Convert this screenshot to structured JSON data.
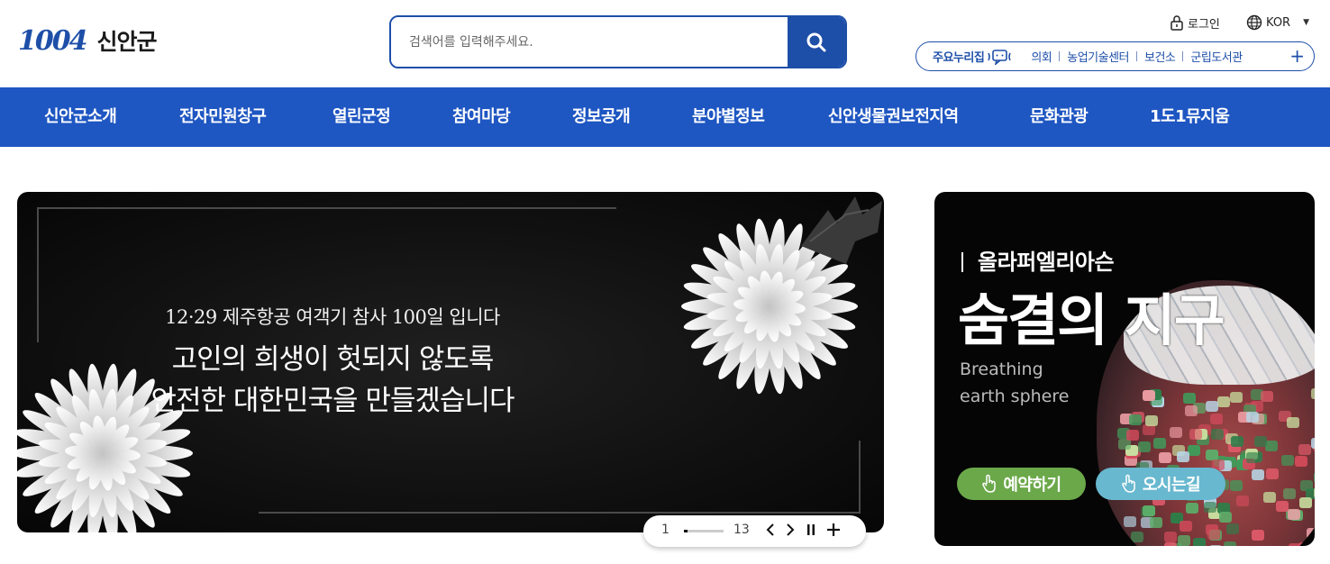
{
  "header": {
    "logo_mark": "1004",
    "logo_text": "신안군",
    "search": {
      "placeholder": "검색어를 입력해주세요."
    },
    "util": {
      "login": "로그인",
      "language": "KOR"
    },
    "quick_links": {
      "title": "주요누리집",
      "items": [
        "의회",
        "농업기술센터",
        "보건소",
        "군립도서관"
      ],
      "more": "+"
    }
  },
  "gnb": {
    "items": [
      "신안군소개",
      "전자민원창구",
      "열린군정",
      "참여마당",
      "정보공개",
      "분야별정보",
      "신안생물권보전지역",
      "문화관광",
      "1도1뮤지움"
    ]
  },
  "main_banner": {
    "subtitle": "12·29 제주항공 여객기 참사 100일 입니다",
    "line1": "고인의 희생이 헛되지 않도록",
    "line2": "안전한 대한민국을 만들겠습니다",
    "pager": {
      "current": "1",
      "total": "13",
      "progress": 0.08
    }
  },
  "side_banner": {
    "subtitle": "올라퍼엘리아슨",
    "title": "숨결의 지구",
    "english_line1": "Breathing",
    "english_line2": "earth sphere",
    "buttons": {
      "book": "예약하기",
      "directions": "오시는길"
    }
  },
  "colors": {
    "primary": "#1e56c2",
    "brand_blue": "#1e4fa8",
    "book_green": "#6ba84a",
    "map_blue": "#68b8cf"
  }
}
